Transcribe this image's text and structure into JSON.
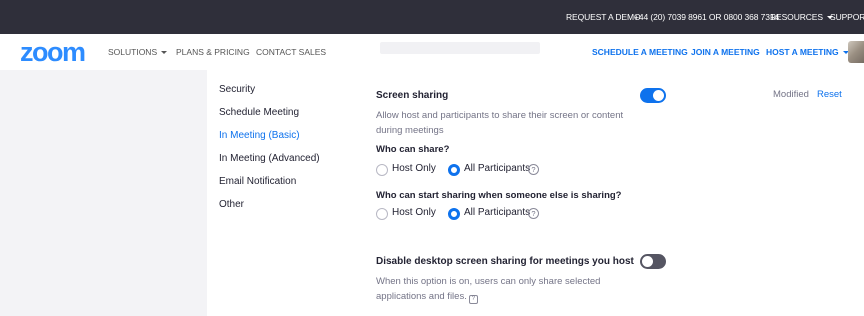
{
  "topbar": {
    "request_demo": "REQUEST A DEMO",
    "phone": "+44 (20) 7039 8961 OR 0800 368 7314",
    "resources": "RESOURCES",
    "support": "SUPPORT"
  },
  "nav": {
    "logo": "zoom",
    "solutions": "SOLUTIONS",
    "plans": "PLANS & PRICING",
    "contact": "CONTACT SALES",
    "schedule": "SCHEDULE A MEETING",
    "join": "JOIN A MEETING",
    "host": "HOST A MEETING"
  },
  "sidebar": {
    "items": [
      {
        "label": "Security",
        "active": false
      },
      {
        "label": "Schedule Meeting",
        "active": false
      },
      {
        "label": "In Meeting (Basic)",
        "active": true
      },
      {
        "label": "In Meeting (Advanced)",
        "active": false
      },
      {
        "label": "Email Notification",
        "active": false
      },
      {
        "label": "Other",
        "active": false
      }
    ]
  },
  "screen_sharing": {
    "title": "Screen sharing",
    "description": "Allow host and participants to share their screen or content during meetings",
    "enabled": true,
    "modified": "Modified",
    "reset": "Reset",
    "who_can_share": {
      "question": "Who can share?",
      "options": [
        "Host Only",
        "All Participants"
      ],
      "selected": "All Participants"
    },
    "who_can_start": {
      "question": "Who can start sharing when someone else is sharing?",
      "options": [
        "Host Only",
        "All Participants"
      ],
      "selected": "All Participants"
    }
  },
  "disable_desktop": {
    "title": "Disable desktop screen sharing for meetings you host",
    "description": "When this option is on, users can only share selected applications and files.",
    "enabled": false
  },
  "colors": {
    "accent": "#0e72ed",
    "topbar": "#2f2f3a",
    "sidebar_bg": "#f3f3f6"
  }
}
